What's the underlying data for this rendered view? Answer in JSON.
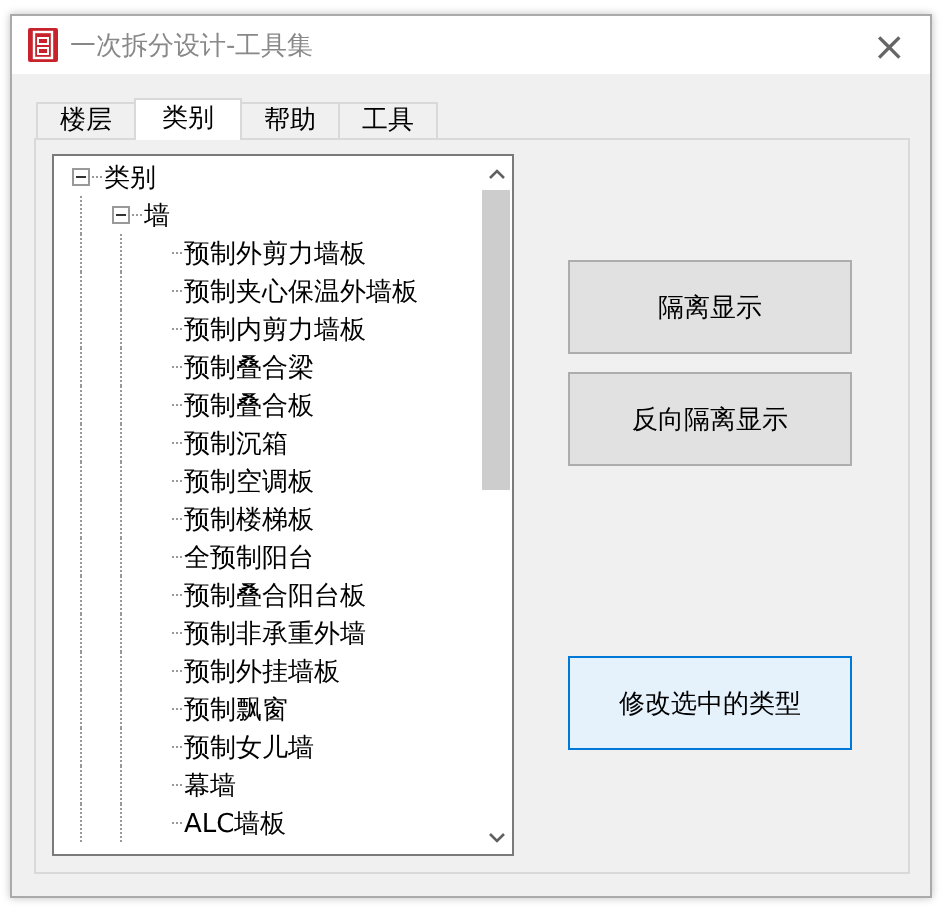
{
  "window": {
    "title": "一次拆分设计-工具集",
    "close": "×"
  },
  "tabs": [
    {
      "label": "楼层",
      "selected": false
    },
    {
      "label": "类别",
      "selected": true
    },
    {
      "label": "帮助",
      "selected": false
    },
    {
      "label": "工具",
      "selected": false
    }
  ],
  "tree": [
    {
      "label": "类别",
      "expanded": true,
      "children": [
        {
          "label": "墙",
          "expanded": true,
          "children": [
            {
              "label": "预制外剪力墙板"
            },
            {
              "label": "预制夹心保温外墙板"
            },
            {
              "label": "预制内剪力墙板"
            },
            {
              "label": "预制叠合梁"
            },
            {
              "label": "预制叠合板"
            },
            {
              "label": "预制沉箱"
            },
            {
              "label": "预制空调板"
            },
            {
              "label": "预制楼梯板"
            },
            {
              "label": "全预制阳台"
            },
            {
              "label": "预制叠合阳台板"
            },
            {
              "label": "预制非承重外墙"
            },
            {
              "label": "预制外挂墙板"
            },
            {
              "label": "预制飘窗"
            },
            {
              "label": "预制女儿墙"
            },
            {
              "label": "幕墙"
            },
            {
              "label": "ALC墙板"
            }
          ]
        }
      ]
    }
  ],
  "buttons": [
    {
      "label": "隔离显示",
      "focused": false
    },
    {
      "label": "反向隔离显示",
      "focused": false
    },
    {
      "label": "修改选中的类型",
      "focused": true
    }
  ]
}
